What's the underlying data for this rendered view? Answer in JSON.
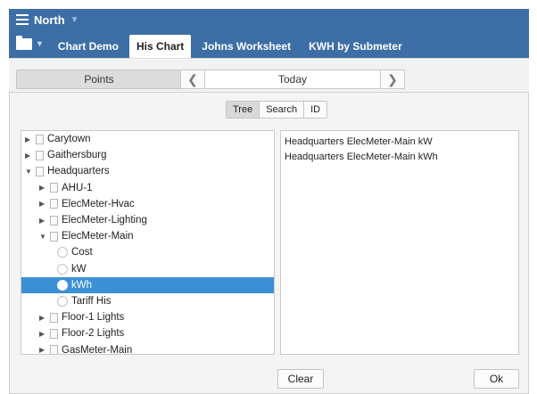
{
  "app": {
    "title": "North"
  },
  "tabs": [
    {
      "label": "Chart Demo",
      "active": false
    },
    {
      "label": "His Chart",
      "active": true
    },
    {
      "label": "Johns Worksheet",
      "active": false
    },
    {
      "label": "KWH by Submeter",
      "active": false
    }
  ],
  "toolbar": {
    "points_label": "Points",
    "prev_icon": "chevron-left-icon",
    "date_label": "Today",
    "next_icon": "chevron-right-icon"
  },
  "dialog": {
    "modes": [
      {
        "label": "Tree",
        "active": true
      },
      {
        "label": "Search",
        "active": false
      },
      {
        "label": "ID",
        "active": false
      }
    ],
    "tree": [
      {
        "label": "Carytown",
        "level": 0,
        "kind": "site",
        "expanded": false
      },
      {
        "label": "Gaithersburg",
        "level": 0,
        "kind": "site",
        "expanded": false
      },
      {
        "label": "Headquarters",
        "level": 0,
        "kind": "site",
        "expanded": true
      },
      {
        "label": "AHU-1",
        "level": 1,
        "kind": "equip",
        "expanded": false
      },
      {
        "label": "ElecMeter-Hvac",
        "level": 1,
        "kind": "equip",
        "expanded": false
      },
      {
        "label": "ElecMeter-Lighting",
        "level": 1,
        "kind": "equip",
        "expanded": false
      },
      {
        "label": "ElecMeter-Main",
        "level": 1,
        "kind": "equip",
        "expanded": true
      },
      {
        "label": "Cost",
        "level": 2,
        "kind": "point",
        "selected": false
      },
      {
        "label": "kW",
        "level": 2,
        "kind": "point",
        "selected": false
      },
      {
        "label": "kWh",
        "level": 2,
        "kind": "point",
        "selected": true
      },
      {
        "label": "Tariff His",
        "level": 2,
        "kind": "point",
        "selected": false
      },
      {
        "label": "Floor-1 Lights",
        "level": 1,
        "kind": "equip",
        "expanded": false
      },
      {
        "label": "Floor-2 Lights",
        "level": 1,
        "kind": "equip",
        "expanded": false
      },
      {
        "label": "GasMeter-Main",
        "level": 1,
        "kind": "equip",
        "expanded": false
      }
    ],
    "selected_points": [
      "Headquarters ElecMeter-Main kW",
      "Headquarters ElecMeter-Main kWh"
    ],
    "clear_label": "Clear",
    "ok_label": "Ok"
  },
  "colors": {
    "header_bg": "#3d6fa6",
    "selection": "#3d8fd6"
  }
}
